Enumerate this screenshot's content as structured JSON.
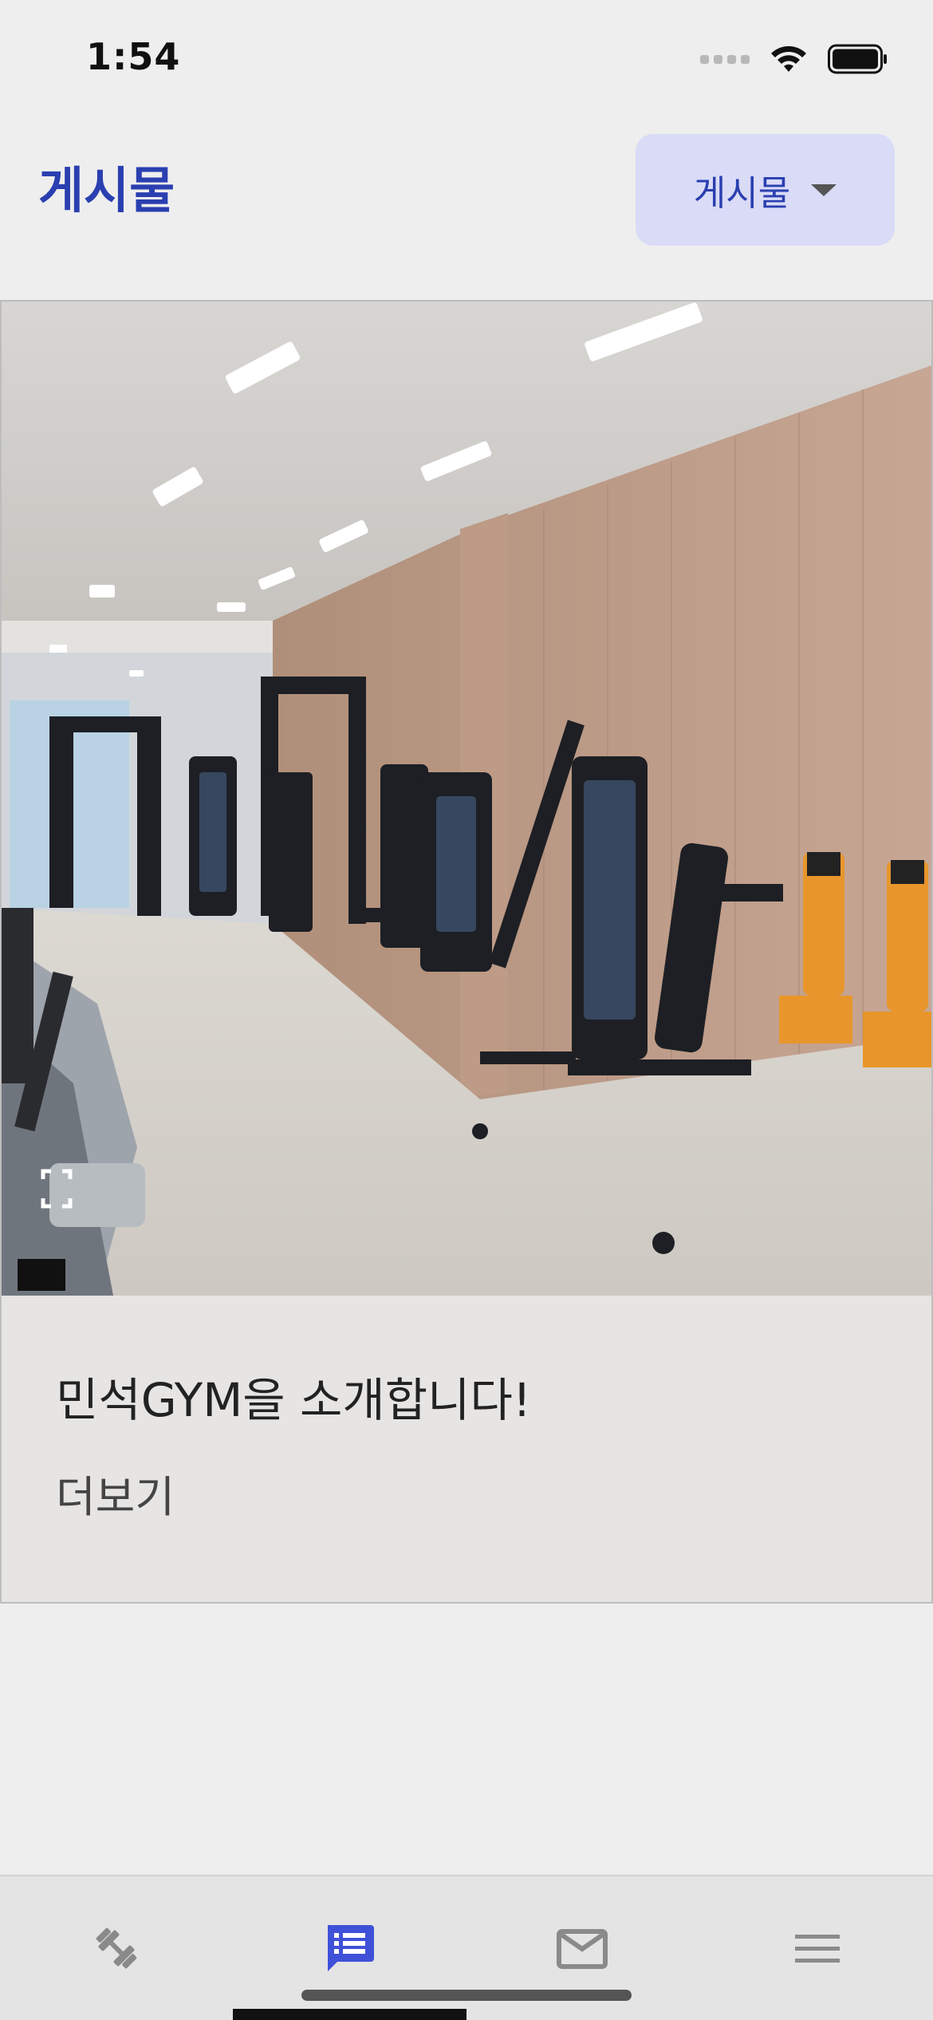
{
  "status_bar": {
    "time": "1:54",
    "icons": [
      "signal-icon",
      "wifi-icon",
      "battery-icon"
    ]
  },
  "header": {
    "title": "게시물",
    "dropdown": {
      "selected": "게시물",
      "icon": "caret-down-icon"
    }
  },
  "post": {
    "image_alt": "gym-interior-photo",
    "title": "민석GYM을 소개합니다!",
    "more_label": "더보기"
  },
  "bottom_nav": {
    "items": [
      {
        "icon": "dumbbell-icon",
        "active": false
      },
      {
        "icon": "posts-icon",
        "active": true
      },
      {
        "icon": "mail-icon",
        "active": false
      },
      {
        "icon": "menu-icon",
        "active": false
      }
    ]
  },
  "colors": {
    "accent": "#2a3fb0",
    "dropdown_bg": "#d9dbf7",
    "background": "#eeeeee",
    "inactive_icon": "#8a8a8a",
    "active_icon": "#3f51d8"
  }
}
